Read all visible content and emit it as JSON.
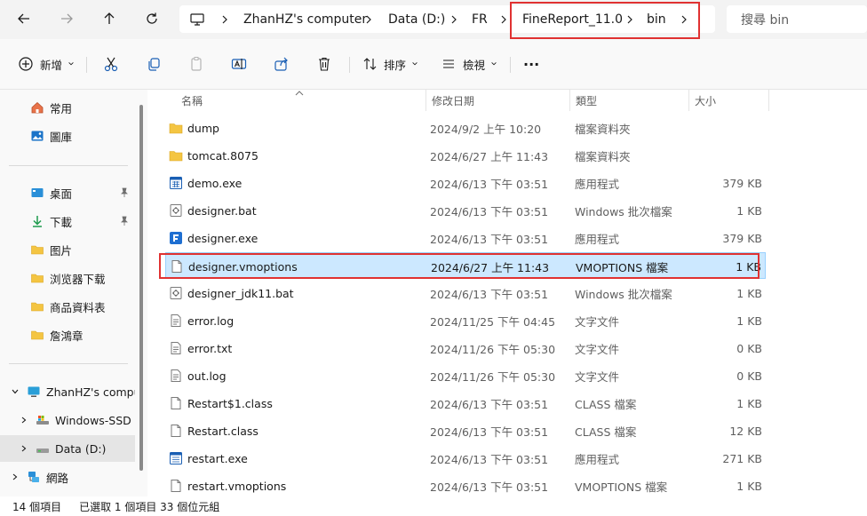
{
  "address": {
    "crumbs": [
      "ZhanHZ's computer",
      "Data (D:)",
      "FR",
      "FineReport_11.0",
      "bin"
    ],
    "search_placeholder": "搜尋 bin"
  },
  "toolbar": {
    "new_label": "新增",
    "sort_label": "排序",
    "view_label": "檢視",
    "more_label": "···"
  },
  "sidebar": {
    "quick": [
      {
        "label": "常用",
        "icon": "home-icon"
      },
      {
        "label": "圖庫",
        "icon": "gallery-icon"
      }
    ],
    "pinned": [
      {
        "label": "桌面",
        "icon": "desktop-icon",
        "pinned": true
      },
      {
        "label": "下載",
        "icon": "download-icon",
        "pinned": true
      },
      {
        "label": "图片",
        "icon": "folder-icon"
      },
      {
        "label": "浏览器下载",
        "icon": "folder-icon"
      },
      {
        "label": "商品資料表",
        "icon": "folder-icon"
      },
      {
        "label": "詹鴻章",
        "icon": "folder-icon"
      }
    ],
    "tree": [
      {
        "label": "ZhanHZ's computer",
        "icon": "computer-icon",
        "expanded": true
      },
      {
        "label": "Windows-SSD (C:)",
        "icon": "drive-icon"
      },
      {
        "label": "Data (D:)",
        "icon": "drive-icon",
        "selected": true
      },
      {
        "label": "網路",
        "icon": "network-icon"
      }
    ]
  },
  "columns": {
    "name": "名稱",
    "date": "修改日期",
    "type": "類型",
    "size": "大小"
  },
  "files": [
    {
      "name": "dump",
      "date": "2024/9/2 上午 10:20",
      "type": "檔案資料夾",
      "size": "",
      "icon": "folder-icon"
    },
    {
      "name": "tomcat.8075",
      "date": "2024/6/27 上午 11:43",
      "type": "檔案資料夾",
      "size": "",
      "icon": "folder-icon"
    },
    {
      "name": "demo.exe",
      "date": "2024/6/13 下午 03:51",
      "type": "應用程式",
      "size": "379 KB",
      "icon": "app-icon"
    },
    {
      "name": "designer.bat",
      "date": "2024/6/13 下午 03:51",
      "type": "Windows 批次檔案",
      "size": "1 KB",
      "icon": "batch-file-icon"
    },
    {
      "name": "designer.exe",
      "date": "2024/6/13 下午 03:51",
      "type": "應用程式",
      "size": "379 KB",
      "icon": "finereport-icon"
    },
    {
      "name": "designer.vmoptions",
      "date": "2024/6/27 上午 11:43",
      "type": "VMOPTIONS 檔案",
      "size": "1 KB",
      "icon": "file-icon",
      "selected": true
    },
    {
      "name": "designer_jdk11.bat",
      "date": "2024/6/13 下午 03:51",
      "type": "Windows 批次檔案",
      "size": "1 KB",
      "icon": "batch-file-icon"
    },
    {
      "name": "error.log",
      "date": "2024/11/25 下午 04:45",
      "type": "文字文件",
      "size": "1 KB",
      "icon": "text-file-icon"
    },
    {
      "name": "error.txt",
      "date": "2024/11/26 下午 05:30",
      "type": "文字文件",
      "size": "0 KB",
      "icon": "text-file-icon"
    },
    {
      "name": "out.log",
      "date": "2024/11/26 下午 05:30",
      "type": "文字文件",
      "size": "0 KB",
      "icon": "text-file-icon"
    },
    {
      "name": "Restart$1.class",
      "date": "2024/6/13 下午 03:51",
      "type": "CLASS 檔案",
      "size": "1 KB",
      "icon": "file-icon"
    },
    {
      "name": "Restart.class",
      "date": "2024/6/13 下午 03:51",
      "type": "CLASS 檔案",
      "size": "12 KB",
      "icon": "file-icon"
    },
    {
      "name": "restart.exe",
      "date": "2024/6/13 下午 03:51",
      "type": "應用程式",
      "size": "271 KB",
      "icon": "app-icon"
    },
    {
      "name": "restart.vmoptions",
      "date": "2024/6/13 下午 03:51",
      "type": "VMOPTIONS 檔案",
      "size": "1 KB",
      "icon": "file-icon"
    }
  ],
  "status": {
    "item_count": "14 個項目",
    "selection": "已選取 1 個項目 33 個位元組"
  },
  "colors": {
    "selection_bg": "#cce8ff",
    "highlight_box": "#e03232",
    "folder": "#f4c542"
  }
}
